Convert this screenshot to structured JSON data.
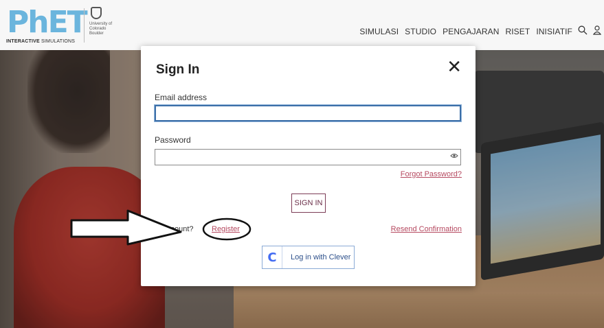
{
  "header": {
    "logo_main": "PhET",
    "logo_sub_bold": "INTERACTIVE",
    "logo_sub": " SIMULATIONS",
    "cu_text": "University of Colorado Boulder",
    "nav": [
      "SIMULASI",
      "STUDIO",
      "PENGAJARAN",
      "RISET",
      "INISIATIF"
    ],
    "search_icon": "search-icon",
    "user_icon": "user-icon"
  },
  "modal": {
    "title": "Sign In",
    "close_symbol": "✕",
    "email_label": "Email address",
    "email_value": "",
    "password_label": "Password",
    "password_value": "",
    "forgot_password": "Forgot Password?",
    "sign_in_button": "SIGN IN",
    "no_account_text": "ccount? ",
    "register_link": "Register",
    "resend_confirmation": "Resend Confirmation",
    "clever_icon": "C",
    "clever_button": "Log in with Clever"
  }
}
